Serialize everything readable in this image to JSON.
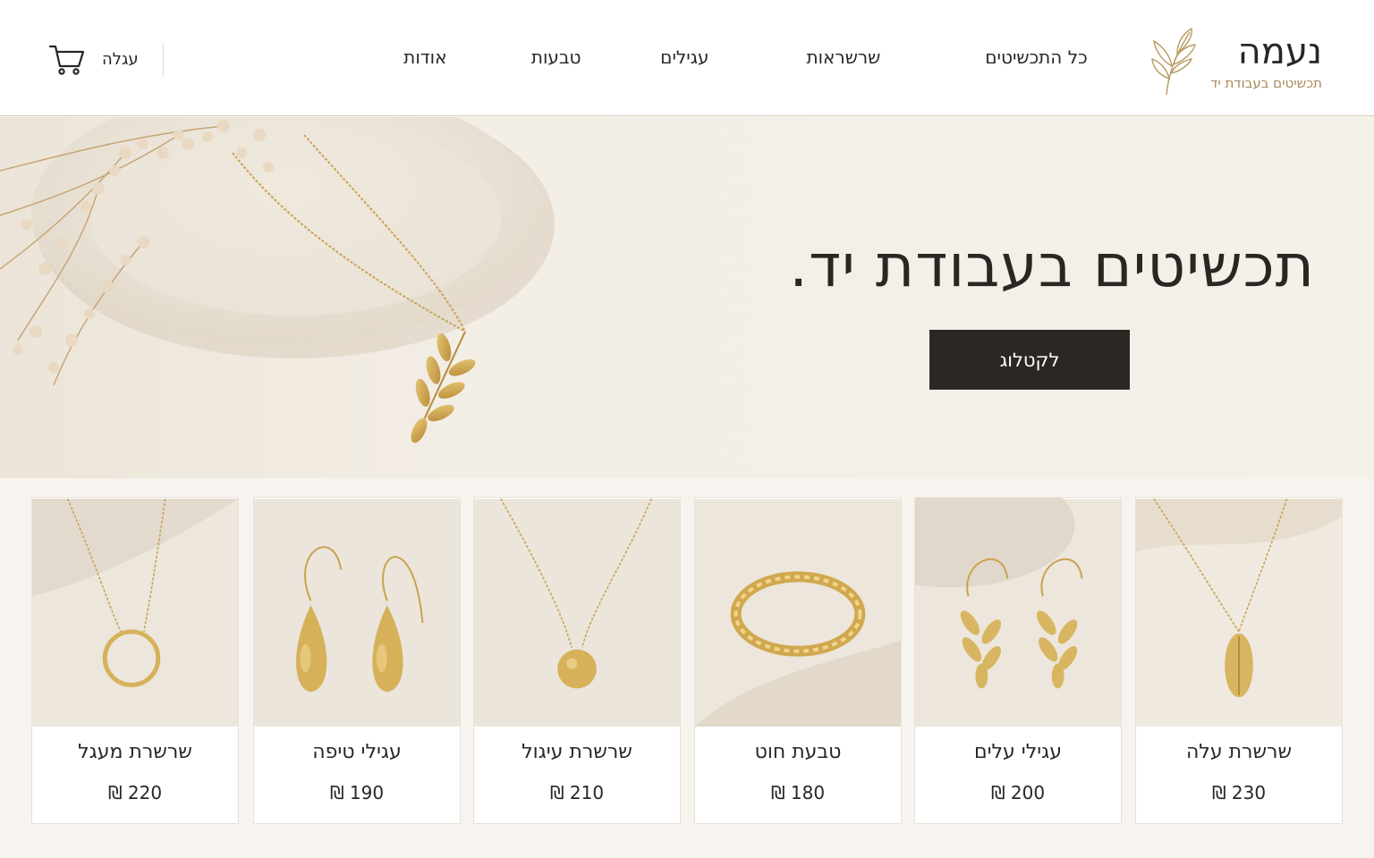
{
  "brand": {
    "name": "נעמה",
    "tagline": "תכשיטים בעבודת יד",
    "accent": "#a8895a"
  },
  "nav": {
    "items": [
      {
        "label": "כל התכשיטים"
      },
      {
        "label": "שרשראות"
      },
      {
        "label": "עגילים"
      },
      {
        "label": "טבעות"
      },
      {
        "label": "אודות"
      }
    ],
    "cart_label": "עגלה",
    "cart_icon": "cart-icon"
  },
  "hero": {
    "title": "תכשיטים בעבודת יד.",
    "button_label": "לקטלוג",
    "button_color": "#2d2723"
  },
  "products": [
    {
      "name": "שרשרת עלה",
      "price": "230 ₪"
    },
    {
      "name": "עגילי עלים",
      "price": "200 ₪"
    },
    {
      "name": "טבעת חוט",
      "price": "180 ₪"
    },
    {
      "name": "שרשרת עיגול",
      "price": "210 ₪"
    },
    {
      "name": "עגילי טיפה",
      "price": "190 ₪"
    },
    {
      "name": "שרשרת מעגל",
      "price": "220 ₪"
    }
  ]
}
